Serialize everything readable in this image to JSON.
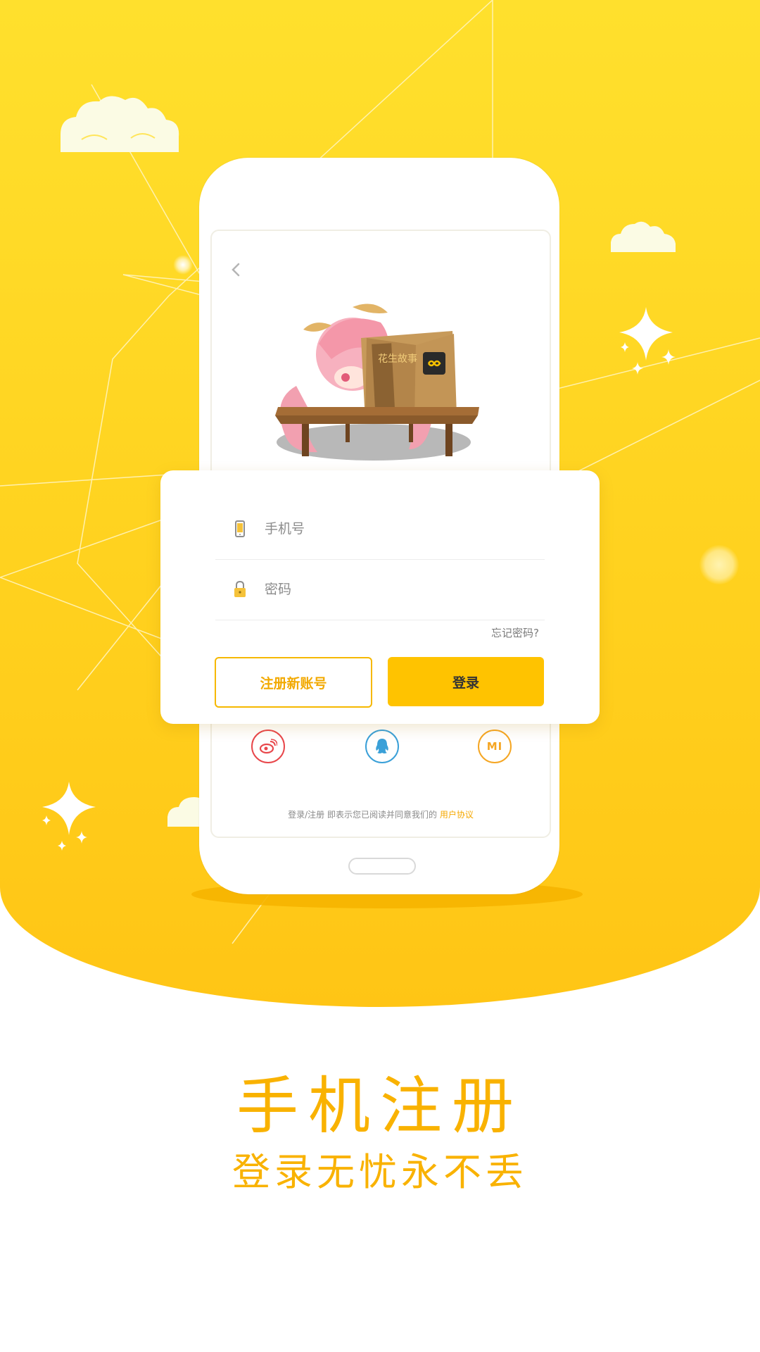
{
  "form": {
    "phone_placeholder": "手机号",
    "password_placeholder": "密码",
    "forgot_label": "忘记密码?",
    "register_label": "注册新账号",
    "login_label": "登录"
  },
  "social": {
    "weibo_icon": "weibo-icon",
    "qq_icon": "qq-icon",
    "xiaomi_icon": "xiaomi-icon",
    "xiaomi_text": "MI"
  },
  "agreement": {
    "text": "登录/注册 即表示您已阅读并同意我们的",
    "link": "用户协议"
  },
  "illustration": {
    "book_cover_text": "花生故事"
  },
  "promo": {
    "headline": "手机注册",
    "subline": "登录无忧永不丢"
  },
  "colors": {
    "brand_yellow": "#ffc300",
    "accent_text": "#f9b200",
    "weibo_red": "#e8474b",
    "qq_blue": "#3aa0d8",
    "xiaomi_orange": "#f5a623"
  }
}
